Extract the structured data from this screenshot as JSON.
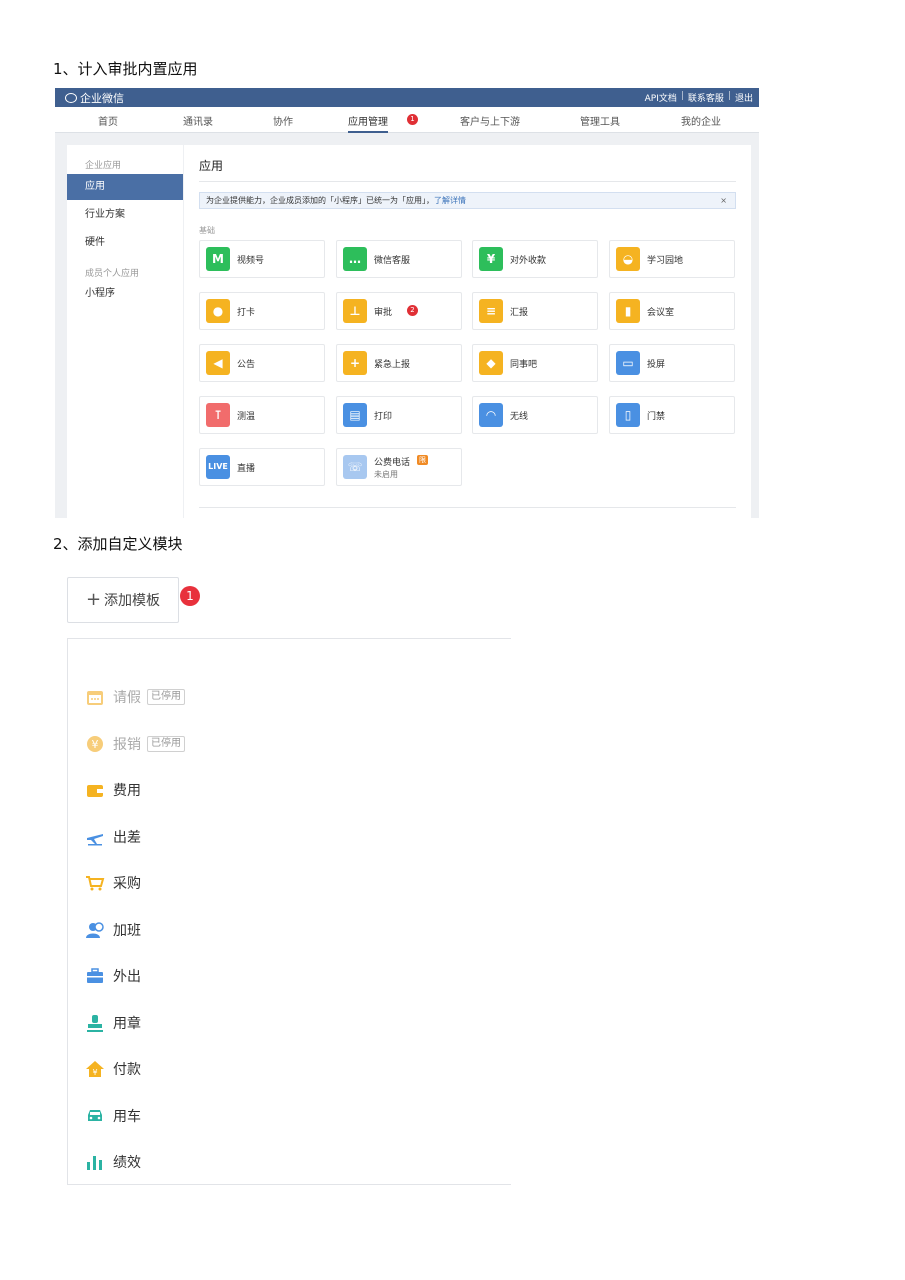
{
  "step1": {
    "title": "1、计入审批内置应用"
  },
  "step2": {
    "title": "2、添加自定义模块"
  },
  "screenshot1": {
    "brand": "企业微信",
    "top_links": [
      "API文档",
      "联系客服",
      "退出"
    ],
    "nav": [
      {
        "label": "首页"
      },
      {
        "label": "通讯录"
      },
      {
        "label": "协作"
      },
      {
        "label": "应用管理",
        "active": true,
        "badge": "1"
      },
      {
        "label": "客户与上下游"
      },
      {
        "label": "管理工具"
      },
      {
        "label": "我的企业"
      }
    ],
    "sidebar": {
      "section1": "企业应用",
      "items": [
        "应用",
        "行业方案",
        "硬件"
      ],
      "section2": "成员个人应用",
      "item_extra": "小程序"
    },
    "main": {
      "title": "应用",
      "notice": "为企业提供能力，企业成员添加的「小程序」已统一为「应用」，",
      "notice_link": "了解详情",
      "notice_close": "×",
      "category": "基础",
      "apps": [
        {
          "name": "视频号",
          "color": "#2dbe5b",
          "glyph": "M"
        },
        {
          "name": "微信客服",
          "color": "#2dbe5b",
          "glyph": "…"
        },
        {
          "name": "对外收款",
          "color": "#2dbe5b",
          "glyph": "¥"
        },
        {
          "name": "学习园地",
          "color": "#f5b321",
          "glyph": "◒"
        },
        {
          "name": "打卡",
          "color": "#f5b321",
          "glyph": "●"
        },
        {
          "name": "审批",
          "color": "#f5b321",
          "glyph": "⊥",
          "badge": "2"
        },
        {
          "name": "汇报",
          "color": "#f5b321",
          "glyph": "≡"
        },
        {
          "name": "会议室",
          "color": "#f5b321",
          "glyph": "▮"
        },
        {
          "name": "公告",
          "color": "#f5b321",
          "glyph": "◀"
        },
        {
          "name": "紧急上报",
          "color": "#f5b321",
          "glyph": "+"
        },
        {
          "name": "同事吧",
          "color": "#f5b321",
          "glyph": "◆"
        },
        {
          "name": "投屏",
          "color": "#4a90e2",
          "glyph": "▭"
        },
        {
          "name": "测温",
          "color": "#f16c6c",
          "glyph": "⊺"
        },
        {
          "name": "打印",
          "color": "#4a90e2",
          "glyph": "▤"
        },
        {
          "name": "无线",
          "color": "#4a90e2",
          "glyph": "◠"
        },
        {
          "name": "门禁",
          "color": "#4a90e2",
          "glyph": "▯"
        },
        {
          "name": "直播",
          "color": "#4a90e2",
          "glyph": "LIVE"
        },
        {
          "name": "公费电话",
          "color": "#a8c8f0",
          "glyph": "☏",
          "sub": "未启用",
          "tag": "限"
        }
      ]
    }
  },
  "screenshot2": {
    "add_button": "添加模板",
    "add_badge": "1",
    "templates": [
      {
        "label": "请假",
        "tag": "已停用",
        "icon": "calendar-icon",
        "color": "#f5b321"
      },
      {
        "label": "报销",
        "tag": "已停用",
        "icon": "yen-icon",
        "color": "#f5b321"
      },
      {
        "label": "费用",
        "icon": "wallet-icon",
        "color": "#f5b321"
      },
      {
        "label": "出差",
        "icon": "airplane-icon",
        "color": "#4a90e2"
      },
      {
        "label": "采购",
        "icon": "cart-icon",
        "color": "#f5b321"
      },
      {
        "label": "加班",
        "icon": "user-clock-icon",
        "color": "#4a90e2"
      },
      {
        "label": "外出",
        "icon": "briefcase-icon",
        "color": "#4a90e2"
      },
      {
        "label": "用章",
        "icon": "stamp-icon",
        "color": "#2bb3a3"
      },
      {
        "label": "付款",
        "icon": "house-yen-icon",
        "color": "#f5b321"
      },
      {
        "label": "用车",
        "icon": "car-icon",
        "color": "#2bb3a3"
      },
      {
        "label": "绩效",
        "icon": "bar-chart-icon",
        "color": "#2bb3a3"
      }
    ]
  }
}
